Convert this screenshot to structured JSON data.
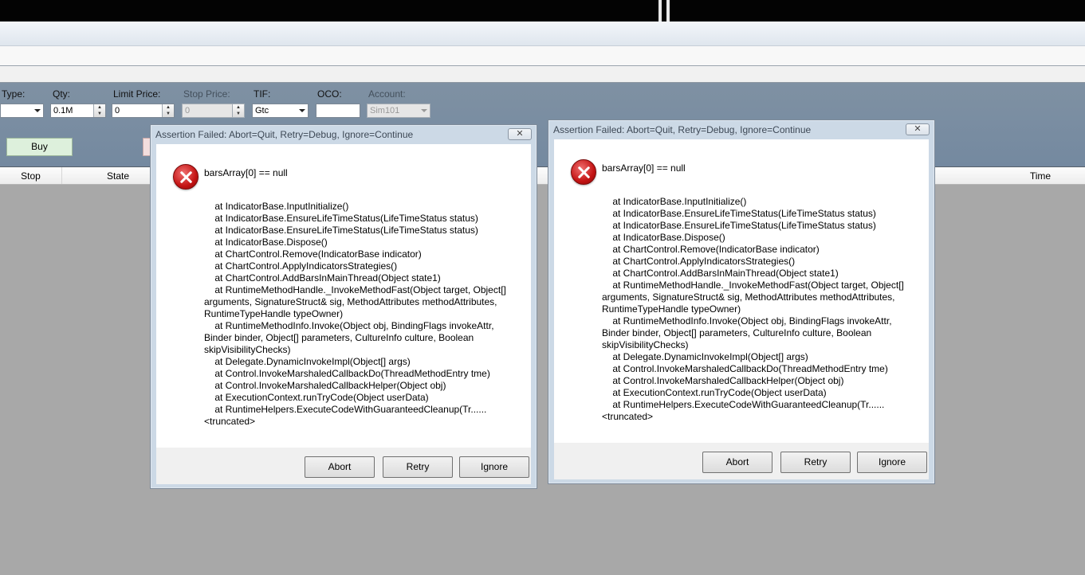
{
  "order_entry": {
    "type_label": "Type:",
    "qty_label": "Qty:",
    "qty_value": "0.1M",
    "limit_label": "Limit Price:",
    "limit_value": "0",
    "stop_label": "Stop Price:",
    "stop_value": "0",
    "tif_label": "TIF:",
    "tif_value": "Gtc",
    "oco_label": "OCO:",
    "oco_value": "",
    "account_label": "Account:",
    "account_value": "Sim101",
    "buy_label": "Buy"
  },
  "grid_header": {
    "stop": "Stop",
    "state": "State",
    "time": "Time"
  },
  "dialogs": [
    {
      "title": "Assertion Failed: Abort=Quit, Retry=Debug, Ignore=Continue",
      "close_glyph": "✕",
      "message": "barsArray[0] == null",
      "stack": [
        "    at IndicatorBase.InputInitialize()",
        "    at IndicatorBase.EnsureLifeTimeStatus(LifeTimeStatus status)",
        "    at IndicatorBase.EnsureLifeTimeStatus(LifeTimeStatus status)",
        "    at IndicatorBase.Dispose()",
        "    at ChartControl.Remove(IndicatorBase indicator)",
        "    at ChartControl.ApplyIndicatorsStrategies()",
        "    at ChartControl.AddBarsInMainThread(Object state1)",
        "    at RuntimeMethodHandle._InvokeMethodFast(Object target, Object[]",
        "arguments, SignatureStruct& sig, MethodAttributes methodAttributes,",
        "RuntimeTypeHandle typeOwner)",
        "    at RuntimeMethodInfo.Invoke(Object obj, BindingFlags invokeAttr,",
        "Binder binder, Object[] parameters, CultureInfo culture, Boolean",
        "skipVisibilityChecks)",
        "    at Delegate.DynamicInvokeImpl(Object[] args)",
        "    at Control.InvokeMarshaledCallbackDo(ThreadMethodEntry tme)",
        "    at Control.InvokeMarshaledCallbackHelper(Object obj)",
        "    at ExecutionContext.runTryCode(Object userData)",
        "    at RuntimeHelpers.ExecuteCodeWithGuaranteedCleanup(Tr......",
        "<truncated>"
      ],
      "buttons": {
        "abort": "Abort",
        "retry": "Retry",
        "ignore": "Ignore"
      }
    },
    {
      "title": "Assertion Failed: Abort=Quit, Retry=Debug, Ignore=Continue",
      "close_glyph": "✕",
      "message": "barsArray[0] == null",
      "stack": [
        "    at IndicatorBase.InputInitialize()",
        "    at IndicatorBase.EnsureLifeTimeStatus(LifeTimeStatus status)",
        "    at IndicatorBase.EnsureLifeTimeStatus(LifeTimeStatus status)",
        "    at IndicatorBase.Dispose()",
        "    at ChartControl.Remove(IndicatorBase indicator)",
        "    at ChartControl.ApplyIndicatorsStrategies()",
        "    at ChartControl.AddBarsInMainThread(Object state1)",
        "    at RuntimeMethodHandle._InvokeMethodFast(Object target, Object[]",
        "arguments, SignatureStruct& sig, MethodAttributes methodAttributes,",
        "RuntimeTypeHandle typeOwner)",
        "    at RuntimeMethodInfo.Invoke(Object obj, BindingFlags invokeAttr,",
        "Binder binder, Object[] parameters, CultureInfo culture, Boolean",
        "skipVisibilityChecks)",
        "    at Delegate.DynamicInvokeImpl(Object[] args)",
        "    at Control.InvokeMarshaledCallbackDo(ThreadMethodEntry tme)",
        "    at Control.InvokeMarshaledCallbackHelper(Object obj)",
        "    at ExecutionContext.runTryCode(Object userData)",
        "    at RuntimeHelpers.ExecuteCodeWithGuaranteedCleanup(Tr......",
        "<truncated>"
      ],
      "buttons": {
        "abort": "Abort",
        "retry": "Retry",
        "ignore": "Ignore"
      }
    }
  ]
}
